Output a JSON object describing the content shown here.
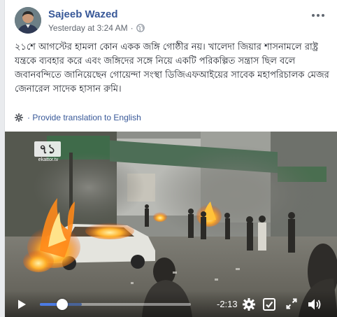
{
  "post": {
    "author": "Sajeeb Wazed",
    "timestamp": "Yesterday at 3:24 AM",
    "separator": "·",
    "privacy_icon": "globe-icon",
    "more_icon": "more-options-icon",
    "text": "২১শে আগস্টের হামলা কোন একক জঙ্গি গোষ্ঠীর নয়। খালেদা জিয়ার শাসনামলে রাষ্ট্র যন্ত্রকে ব্যবহার করে এবং জঙ্গিদের সঙ্গে নিয়ে একটি পরিকল্পিত সন্ত্রাস ছিল বলে জবানবন্দিতে জানিয়েছেন গোয়েন্দা সংস্থা ডিজিএফআইয়ের সাবেক মহাপরিচালক মেজর জেনারেল সাদেক হাসান রুমি।",
    "translate_label": "· Provide translation to English"
  },
  "video": {
    "channel_mark": "৭১",
    "channel_site": "ekattor.tv",
    "remaining_time": "-2:13",
    "progress": 0.15,
    "buffered": 0.28,
    "icons": {
      "play": "play-icon",
      "settings": "gear-icon",
      "hd": "hd-icon",
      "fullscreen": "expand-icon",
      "volume": "volume-icon"
    }
  },
  "colors": {
    "link": "#385898",
    "progress": "#4c7be3",
    "text": "#1d2129",
    "meta": "#616770"
  }
}
